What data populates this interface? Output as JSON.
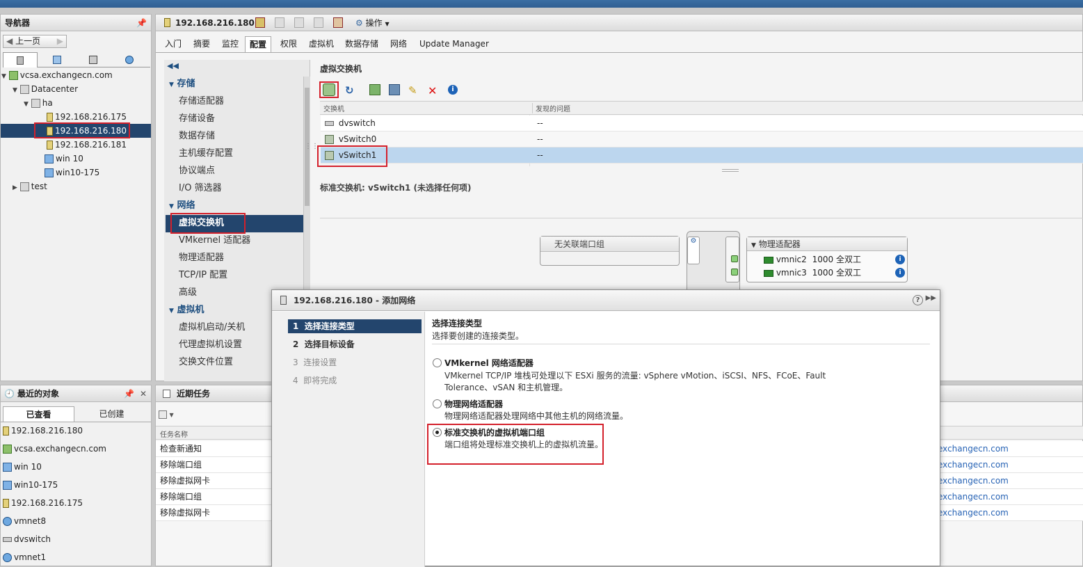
{
  "navigator": {
    "title": "导航器",
    "back_label": "上一页",
    "tree": [
      {
        "label": "vcsa.exchangecn.com",
        "icon": "vcenter-icon"
      },
      {
        "label": "Datacenter",
        "icon": "datacenter-icon"
      },
      {
        "label": "ha",
        "icon": "cluster-icon"
      },
      {
        "label": "192.168.216.175",
        "icon": "host-warning-icon"
      },
      {
        "label": "192.168.216.180",
        "icon": "host-warning-icon"
      },
      {
        "label": "192.168.216.181",
        "icon": "host-warning-icon"
      },
      {
        "label": "win 10",
        "icon": "vm-icon"
      },
      {
        "label": "win10-175",
        "icon": "vm-icon"
      },
      {
        "label": "test",
        "icon": "datacenter-icon"
      }
    ]
  },
  "header": {
    "host_title": "192.168.216.180",
    "actions_label": "操作"
  },
  "tabs": [
    "入门",
    "摘要",
    "监控",
    "配置",
    "权限",
    "虚拟机",
    "数据存储",
    "网络",
    "Update Manager"
  ],
  "config_nav": {
    "storage": {
      "title": "存储",
      "items": [
        "存储适配器",
        "存储设备",
        "数据存储",
        "主机缓存配置",
        "协议端点",
        "I/O 筛选器"
      ]
    },
    "network": {
      "title": "网络",
      "items": [
        "虚拟交换机",
        "VMkernel 适配器",
        "物理适配器",
        "TCP/IP 配置",
        "高级"
      ]
    },
    "vm": {
      "title": "虚拟机",
      "items": [
        "虚拟机启动/关机",
        "代理虚拟机设置",
        "交换文件位置"
      ]
    }
  },
  "vswitch": {
    "title": "虚拟交换机",
    "col_switch": "交换机",
    "col_issues": "发现的问题",
    "rows": [
      {
        "name": "dvswitch",
        "issues": "--"
      },
      {
        "name": "vSwitch0",
        "issues": "--"
      },
      {
        "name": "vSwitch1",
        "issues": "--"
      }
    ],
    "detail_title": "标准交换机: vSwitch1 (未选择任何项)",
    "unlinked_pg": "无关联端口组",
    "phys_adapters_title": "物理适配器",
    "nics": [
      {
        "name": "vmnic2",
        "speed": "1000",
        "duplex": "全双工"
      },
      {
        "name": "vmnic3",
        "speed": "1000",
        "duplex": "全双工"
      }
    ]
  },
  "recent_objects": {
    "title": "最近的对象",
    "tab_viewed": "已查看",
    "tab_created": "已创建",
    "items": [
      {
        "label": "192.168.216.180",
        "icon": "host-warning-icon"
      },
      {
        "label": "vcsa.exchangecn.com",
        "icon": "vcenter-icon"
      },
      {
        "label": "win 10",
        "icon": "vm-icon"
      },
      {
        "label": "win10-175",
        "icon": "vm-icon"
      },
      {
        "label": "192.168.216.175",
        "icon": "host-warning-icon"
      },
      {
        "label": "vmnet8",
        "icon": "network-icon"
      },
      {
        "label": "dvswitch",
        "icon": "dvswitch-icon"
      },
      {
        "label": "vmnet1",
        "icon": "network-icon"
      }
    ]
  },
  "recent_tasks": {
    "title": "近期任务",
    "col_task": "任务名称",
    "rows": [
      {
        "task": "检查新通知",
        "target": "exchangecn.com"
      },
      {
        "task": "移除端口组",
        "target": "exchangecn.com"
      },
      {
        "task": "移除虚拟网卡",
        "target": "exchangecn.com"
      },
      {
        "task": "移除端口组",
        "target": "exchangecn.com"
      },
      {
        "task": "移除虚拟网卡",
        "target": "exchangecn.com"
      }
    ]
  },
  "dialog": {
    "title": "192.168.216.180 - 添加网络",
    "steps": [
      {
        "num": "1",
        "label": "选择连接类型"
      },
      {
        "num": "2",
        "label": "选择目标设备"
      },
      {
        "num": "3",
        "label": "连接设置"
      },
      {
        "num": "4",
        "label": "即将完成"
      }
    ],
    "heading": "选择连接类型",
    "subheading": "选择要创建的连接类型。",
    "options": [
      {
        "title": "VMkernel 网络适配器",
        "desc1": "VMkernel TCP/IP 堆栈可处理以下 ESXi 服务的流量: vSphere vMotion、iSCSI、NFS、FCoE、Fault",
        "desc2": "Tolerance、vSAN 和主机管理。",
        "selected": false
      },
      {
        "title": "物理网络适配器",
        "desc1": "物理网络适配器处理网络中其他主机的网络流量。",
        "desc2": "",
        "selected": false
      },
      {
        "title": "标准交换机的虚拟机端口组",
        "desc1": "端口组将处理标准交换机上的虚拟机流量。",
        "desc2": "",
        "selected": true
      }
    ]
  }
}
